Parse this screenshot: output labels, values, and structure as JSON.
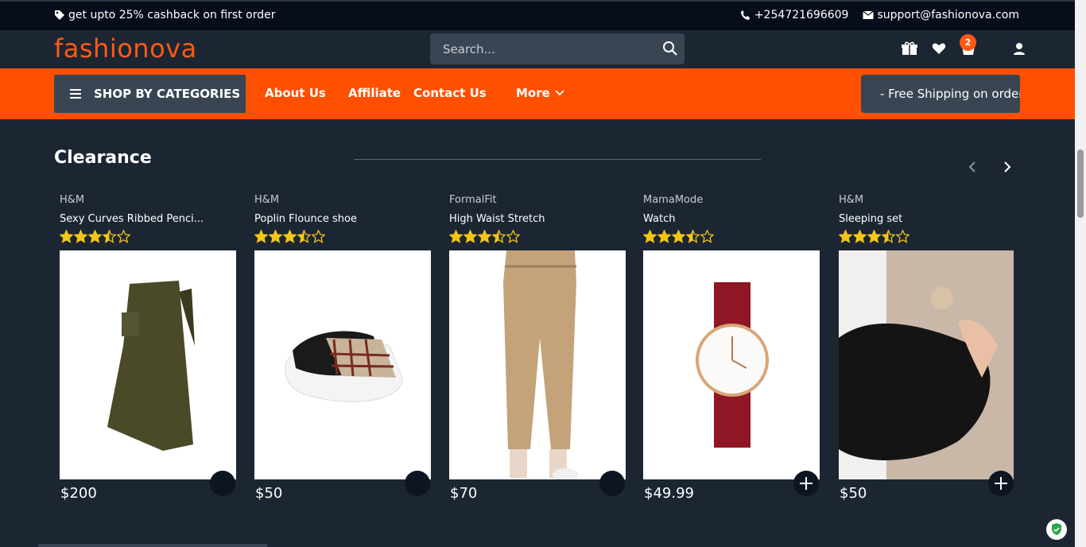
{
  "topbar": {
    "promo": "get upto 25% cashback on first order",
    "phone": "+254721696609",
    "email": "support@fashionova.com"
  },
  "header": {
    "logo": "fashionova",
    "search_placeholder": "Search...",
    "cart_count": "2"
  },
  "nav": {
    "categories": "SHOP BY CATEGORIES",
    "about": "About Us",
    "affiliate": "Affiliate",
    "contact": "Contact Us",
    "more": "More",
    "free_shipping": "- Free Shipping on orders"
  },
  "section": {
    "title": "Clearance"
  },
  "products": [
    {
      "brand": "H&M",
      "name": "Sexy Curves Ribbed Penci...",
      "price": "$200",
      "rating": 3.5
    },
    {
      "brand": "H&M",
      "name": "Poplin Flounce shoe",
      "price": "$50",
      "rating": 3.5
    },
    {
      "brand": "FormalFit",
      "name": "High Waist Stretch",
      "price": "$70",
      "rating": 3.5
    },
    {
      "brand": "MamaMode",
      "name": "Watch",
      "price": "$49.99",
      "rating": 3.5
    },
    {
      "brand": "H&M",
      "name": "Sleeping set",
      "price": "$50",
      "rating": 3.5
    }
  ],
  "colors": {
    "accent": "#ff4f00",
    "background": "#1c2633",
    "star": "#f5c518"
  }
}
